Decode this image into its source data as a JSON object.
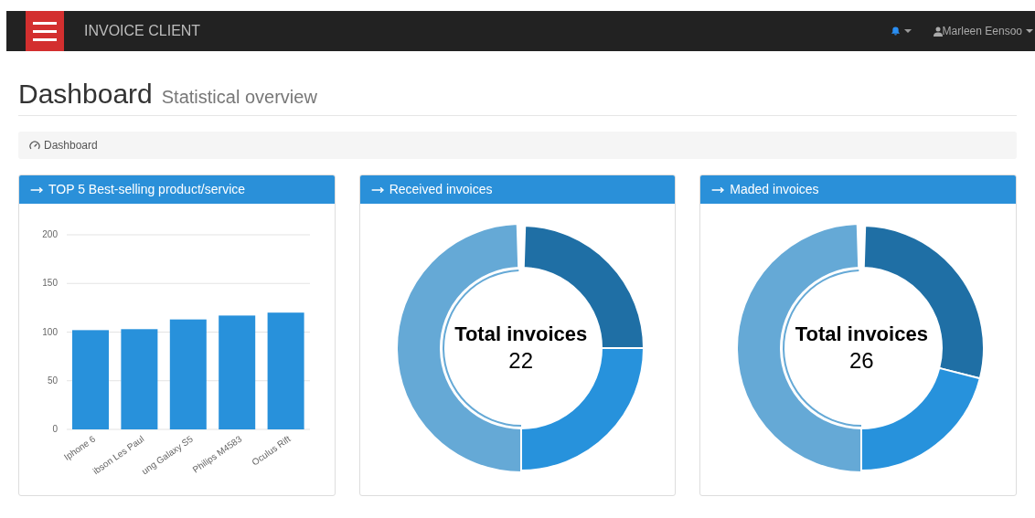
{
  "navbar": {
    "brand": "INVOICE CLIENT",
    "user": "Marleen Eensoo"
  },
  "header": {
    "title": "Dashboard",
    "subtitle": "Statistical overview"
  },
  "breadcrumb": {
    "label": "Dashboard"
  },
  "panels": [
    {
      "kind": "bar",
      "title": "TOP 5 Best-selling product/service",
      "chart_data": {
        "type": "bar",
        "categories": [
          "Iphone 6",
          "ibson Les Paul",
          "ung Galaxy S5",
          "Philips M4583",
          "Oculus Rift"
        ],
        "values": [
          102,
          103,
          113,
          117,
          120
        ],
        "ylim": [
          0,
          200
        ],
        "grid": true,
        "yticks": [
          0,
          50,
          100,
          150,
          200
        ]
      }
    },
    {
      "kind": "donut",
      "title": "Received invoices",
      "center_label": "Total invoices",
      "total": "22"
    },
    {
      "kind": "donut",
      "title": "Maded invoices",
      "center_label": "Total invoices",
      "total": "26"
    }
  ]
}
